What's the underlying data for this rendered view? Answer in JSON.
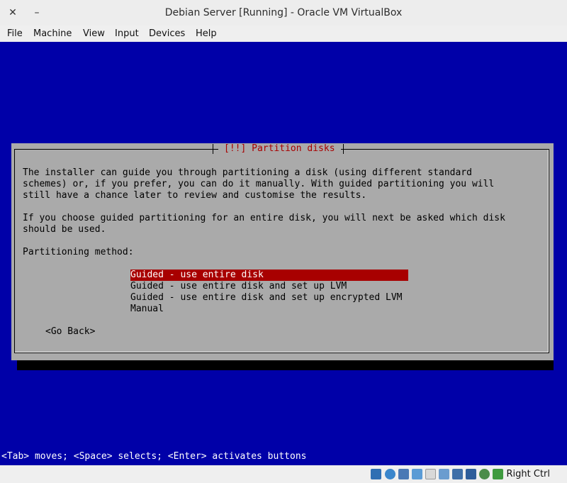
{
  "window": {
    "title": "Debian Server [Running] - Oracle VM VirtualBox",
    "close_glyph": "✕",
    "minimize_glyph": "–"
  },
  "menu": [
    "File",
    "Machine",
    "View",
    "Input",
    "Devices",
    "Help"
  ],
  "dialog": {
    "title": "[!!] Partition disks",
    "paragraph1": [
      "The installer can guide you through partitioning a disk (using different standard",
      "schemes) or, if you prefer, you can do it manually. With guided partitioning you will",
      "still have a chance later to review and customise the results."
    ],
    "paragraph2": [
      "If you choose guided partitioning for an entire disk, you will next be asked which disk",
      "should be used."
    ],
    "method_label": "Partitioning method:",
    "options": [
      "Guided - use entire disk",
      "Guided - use entire disk and set up LVM",
      "Guided - use entire disk and set up encrypted LVM",
      "Manual"
    ],
    "selected_index": 0,
    "go_back": "<Go Back>"
  },
  "hint": "<Tab> moves; <Space> selects; <Enter> activates buttons",
  "statusbar": {
    "host_key": "Right Ctrl",
    "icons": [
      "hard-disk-icon",
      "optical-drive-icon",
      "audio-icon",
      "network-icon",
      "usb-icon",
      "shared-folders-icon",
      "display-icon",
      "video-capture-icon",
      "virtualization-icon",
      "mouse-integration-icon",
      "keyboard-icon"
    ]
  },
  "colors": {
    "vm_background": "#0000a8",
    "dialog_background": "#aaaaaa",
    "title_red": "#a80000",
    "selection_red": "#a80000"
  }
}
